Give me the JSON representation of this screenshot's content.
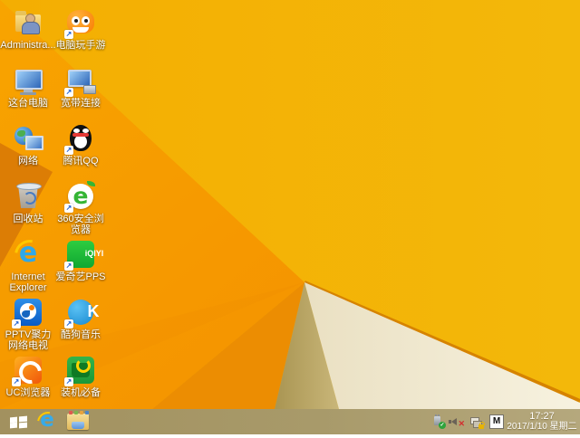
{
  "desktop": {
    "icons": [
      {
        "label": "Administra...",
        "name": "administrator-folder",
        "shortcut": false
      },
      {
        "label": "电脑玩手游",
        "name": "pc-mobile-games",
        "shortcut": true
      },
      {
        "label": "这台电脑",
        "name": "this-pc",
        "shortcut": false
      },
      {
        "label": "宽带连接",
        "name": "broadband-connection",
        "shortcut": true
      },
      {
        "label": "网络",
        "name": "network",
        "shortcut": false
      },
      {
        "label": "腾讯QQ",
        "name": "tencent-qq",
        "shortcut": true
      },
      {
        "label": "回收站",
        "name": "recycle-bin",
        "shortcut": false
      },
      {
        "label": "360安全浏览器",
        "name": "360-secure-browser",
        "shortcut": true
      },
      {
        "label": "Internet Explorer",
        "name": "internet-explorer",
        "shortcut": false
      },
      {
        "label": "爱奇艺PPS",
        "name": "iqiyi-pps",
        "shortcut": true
      },
      {
        "label": "PPTV聚力 网络电视",
        "name": "pptv-network-tv",
        "shortcut": true
      },
      {
        "label": "酷狗音乐",
        "name": "kugou-music",
        "shortcut": true
      },
      {
        "label": "UC浏览器",
        "name": "uc-browser",
        "shortcut": true
      },
      {
        "label": "装机必备",
        "name": "essential-apps",
        "shortcut": true
      }
    ],
    "iqiyi_text": "iQIYI",
    "kugou_text": "K",
    "browser360_text": "e"
  },
  "taskbar": {
    "buttons": [
      "start",
      "internet-explorer",
      "file-explorer"
    ],
    "tray": {
      "icons": [
        "usb-safely-remove",
        "volume-muted",
        "network-status",
        "ime-indicator"
      ],
      "ime_badge": "M",
      "time": "17:27",
      "date": "2017/1/10 星期二"
    }
  },
  "colors": {
    "wallpaper_gold": "#F2B406",
    "wallpaper_orange": "#F79E00",
    "wallpaper_deep_orange": "#EC8D02",
    "wallpaper_dark_triangle": "#DC7D05",
    "wallpaper_tan_wedge": "#B9A567",
    "wallpaper_cream": "#F2EBD3",
    "fold_stroke": "#D68300",
    "taskbar": "#A89A6A",
    "label_text": "#FFFFFF"
  }
}
